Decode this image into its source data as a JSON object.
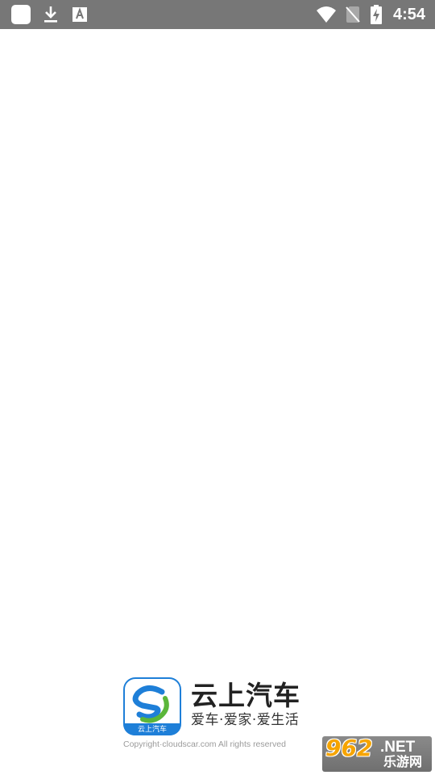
{
  "status_bar": {
    "time": "4:54",
    "icons": [
      "app-square-icon",
      "download-icon",
      "font-a-icon",
      "wifi-icon",
      "no-sim-icon",
      "battery-charging-icon"
    ],
    "background": "#777777"
  },
  "splash": {
    "logo": {
      "icon": "cloud-car-s-logo-icon",
      "caption": "云上汽车",
      "colors": {
        "blue": "#1e7fd8",
        "green": "#5ab63a"
      }
    },
    "brand_name": "云上汽车",
    "slogan": "爱车·爱家·爱生活",
    "copyright": "Copyright·cloudscar.com All rights reserved"
  },
  "watermark": {
    "number": "962",
    "suffix": ".NET",
    "chinese": "乐游网",
    "color": "#f6a400"
  }
}
